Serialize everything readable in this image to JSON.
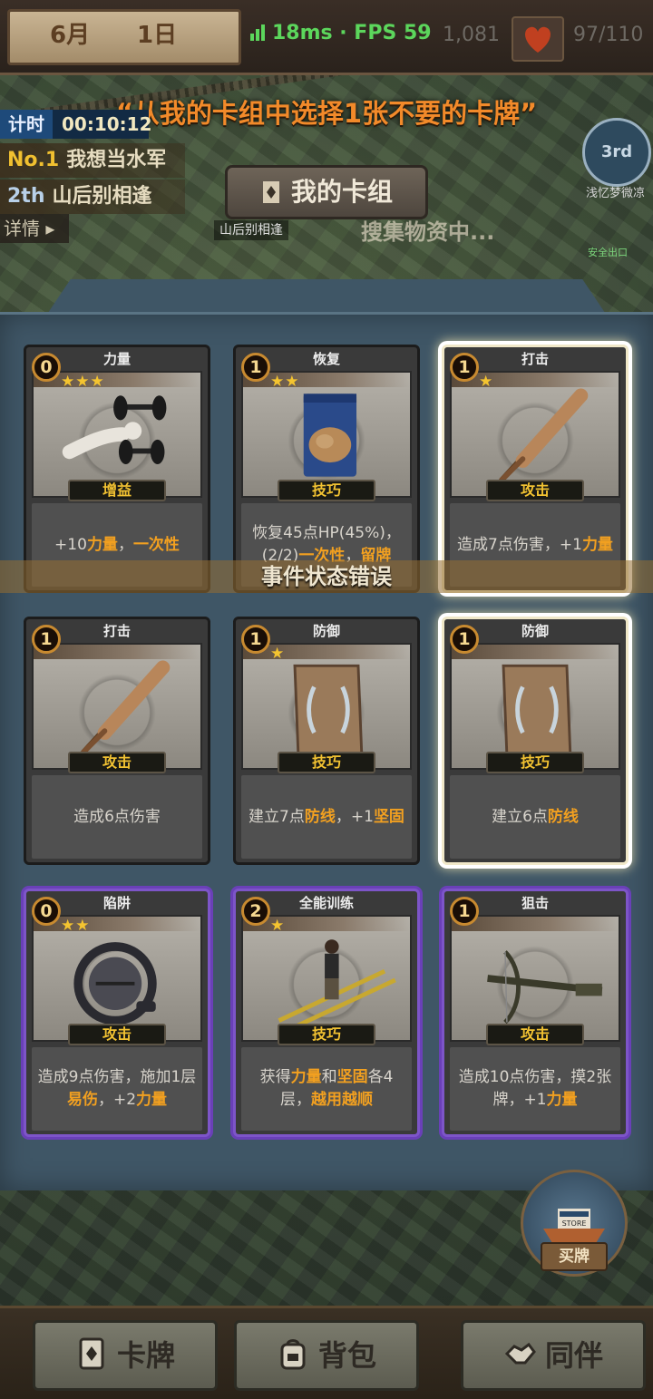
{
  "top_bar": {
    "date_month": "6月",
    "date_day": "1日",
    "network": "18ms · FPS 59",
    "coins": "1,081",
    "hp": "97/110"
  },
  "headline": "“从我的卡组中选择1张不要的卡牌”",
  "hud": {
    "timer_label": "计时",
    "timer_value": "00:10:12",
    "rank1_num": "No.1",
    "rank1_name": "我想当水军",
    "rank2_num": "2th",
    "rank2_name": "山后别相逢",
    "details": "详情 ▸"
  },
  "deck_tab": "我的卡组",
  "map": {
    "location_label": "山后别相逢",
    "collecting": "搜集物资中...",
    "third_badge": "3rd",
    "third_name": "浅忆梦微凉",
    "exit_label": "安全出口"
  },
  "cards": [
    {
      "cost": "0",
      "title": "力量",
      "stars": "★★★",
      "type": "增益",
      "art_icon": "dumbbell-icon",
      "desc_parts": [
        {
          "t": "+10"
        },
        {
          "t": "力量",
          "hl": true
        },
        {
          "t": "，"
        },
        {
          "t": "一次性",
          "hl": true
        }
      ],
      "frame": "normal"
    },
    {
      "cost": "1",
      "title": "恢复",
      "stars": "★★",
      "type": "技巧",
      "art_icon": "cookie-bag-icon",
      "desc_parts": [
        {
          "t": "恢复45点HP(45%)，(2/2)"
        },
        {
          "t": "一次性",
          "hl": true
        },
        {
          "t": "，"
        },
        {
          "t": "留牌",
          "hl": true
        }
      ],
      "frame": "normal"
    },
    {
      "cost": "1",
      "title": "打击",
      "stars": "★",
      "type": "攻击",
      "art_icon": "bat-icon",
      "desc_parts": [
        {
          "t": "造成7点伤害，+1"
        },
        {
          "t": "力量",
          "hl": true
        }
      ],
      "frame": "selected"
    },
    {
      "cost": "1",
      "title": "打击",
      "stars": "",
      "type": "攻击",
      "art_icon": "bat-icon",
      "desc_parts": [
        {
          "t": "造成6点伤害"
        }
      ],
      "frame": "normal"
    },
    {
      "cost": "1",
      "title": "防御",
      "stars": "★",
      "type": "技巧",
      "art_icon": "shield-icon",
      "desc_parts": [
        {
          "t": "建立7点"
        },
        {
          "t": "防线",
          "hl": true
        },
        {
          "t": "，+1"
        },
        {
          "t": "坚固",
          "hl": true
        }
      ],
      "frame": "normal"
    },
    {
      "cost": "1",
      "title": "防御",
      "stars": "",
      "type": "技巧",
      "art_icon": "shield-icon",
      "desc_parts": [
        {
          "t": "建立6点"
        },
        {
          "t": "防线",
          "hl": true
        }
      ],
      "frame": "selected"
    },
    {
      "cost": "0",
      "title": "陷阱",
      "stars": "★★",
      "type": "攻击",
      "art_icon": "bear-trap-icon",
      "desc_parts": [
        {
          "t": "造成9点伤害，施加1层"
        },
        {
          "t": "易伤",
          "hl": true
        },
        {
          "t": "，+2"
        },
        {
          "t": "力量",
          "hl": true
        }
      ],
      "frame": "purple"
    },
    {
      "cost": "2",
      "title": "全能训练",
      "stars": "★",
      "type": "技巧",
      "art_icon": "ladder-training-icon",
      "desc_parts": [
        {
          "t": "获得"
        },
        {
          "t": "力量",
          "hl": true
        },
        {
          "t": "和"
        },
        {
          "t": "坚固",
          "hl": true
        },
        {
          "t": "各4层，"
        },
        {
          "t": "越用越顺",
          "hl": true
        }
      ],
      "frame": "purple"
    },
    {
      "cost": "1",
      "title": "狙击",
      "stars": "",
      "type": "攻击",
      "art_icon": "crossbow-icon",
      "desc_parts": [
        {
          "t": "造成10点伤害，摸2张牌，+1"
        },
        {
          "t": "力量",
          "hl": true
        }
      ],
      "frame": "purple"
    }
  ],
  "error_overlay": "事件状态错误",
  "store": {
    "label": "买牌",
    "sign": "STORE"
  },
  "bottom_nav": {
    "cards": "卡牌",
    "bag": "背包",
    "companions": "同伴"
  },
  "colors": {
    "highlight": "#f2a020",
    "headline": "#f28a2a",
    "panel": "#3f5666",
    "purple_frame": "#7d55c8"
  }
}
